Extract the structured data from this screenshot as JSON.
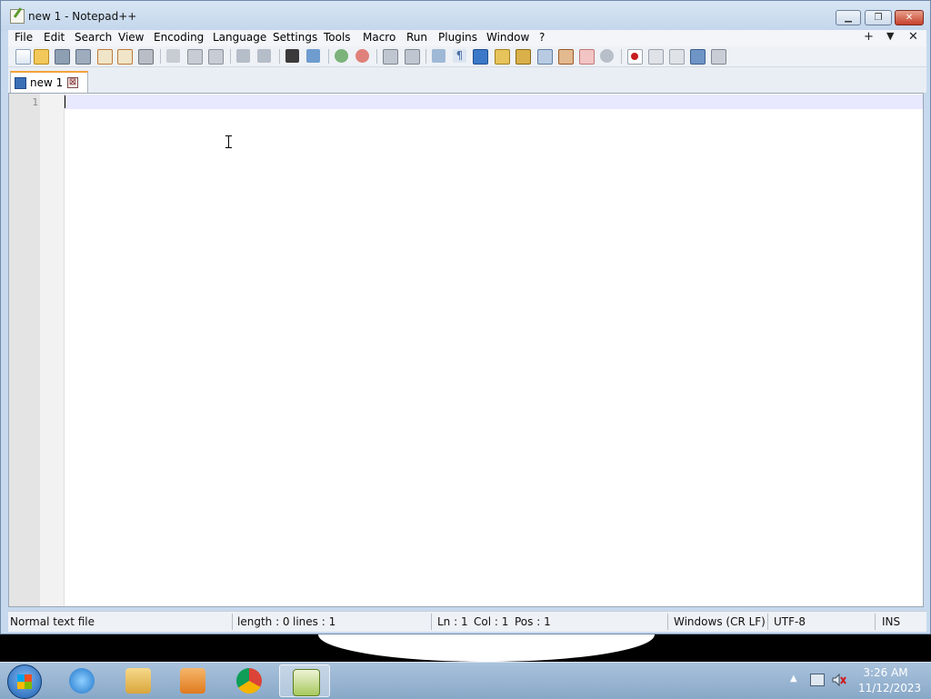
{
  "window": {
    "title": "new 1 - Notepad++"
  },
  "menu": {
    "items": [
      "File",
      "Edit",
      "Search",
      "View",
      "Encoding",
      "Language",
      "Settings",
      "Tools",
      "Macro",
      "Run",
      "Plugins",
      "Window",
      "?"
    ],
    "right": [
      "+",
      "▼",
      "✕"
    ]
  },
  "toolbar": {
    "icons": [
      "new-file-icon",
      "open-file-icon",
      "save-icon",
      "save-all-icon",
      "close-icon",
      "close-all-icon",
      "print-icon",
      "cut-icon",
      "copy-icon",
      "paste-icon",
      "undo-icon",
      "redo-icon",
      "find-icon",
      "replace-icon",
      "zoom-in-icon",
      "zoom-out-icon",
      "sync-vertical-icon",
      "sync-horizontal-icon",
      "word-wrap-icon",
      "show-all-chars-icon",
      "indent-guide-icon",
      "doc-map-icon",
      "function-list-icon",
      "folder-workspace-icon",
      "monitoring-icon",
      "record-macro-icon",
      "stop-record-icon",
      "play-macro-icon",
      "run-macro-multiple-icon",
      "save-macro-icon"
    ]
  },
  "tabs": [
    {
      "label": "new 1",
      "close": "⊠"
    }
  ],
  "editor": {
    "line_numbers": [
      "1"
    ]
  },
  "status": {
    "type": "Normal text file",
    "length": "length : 0",
    "lines": "lines : 1",
    "ln": "Ln : 1",
    "col": "Col : 1",
    "pos": "Pos : 1",
    "eol": "Windows (CR LF)",
    "encoding": "UTF-8",
    "mode": "INS"
  },
  "taskbar": {
    "apps": [
      "start-button",
      "internet-explorer",
      "file-explorer",
      "media-player",
      "chrome",
      "notepad-plus-plus"
    ],
    "time": "3:26 AM",
    "date": "11/12/2023"
  },
  "colors": {
    "tab_accent": "#f3a33a",
    "line_highlight": "#e8e8ff",
    "close_button": "#c5402c"
  }
}
